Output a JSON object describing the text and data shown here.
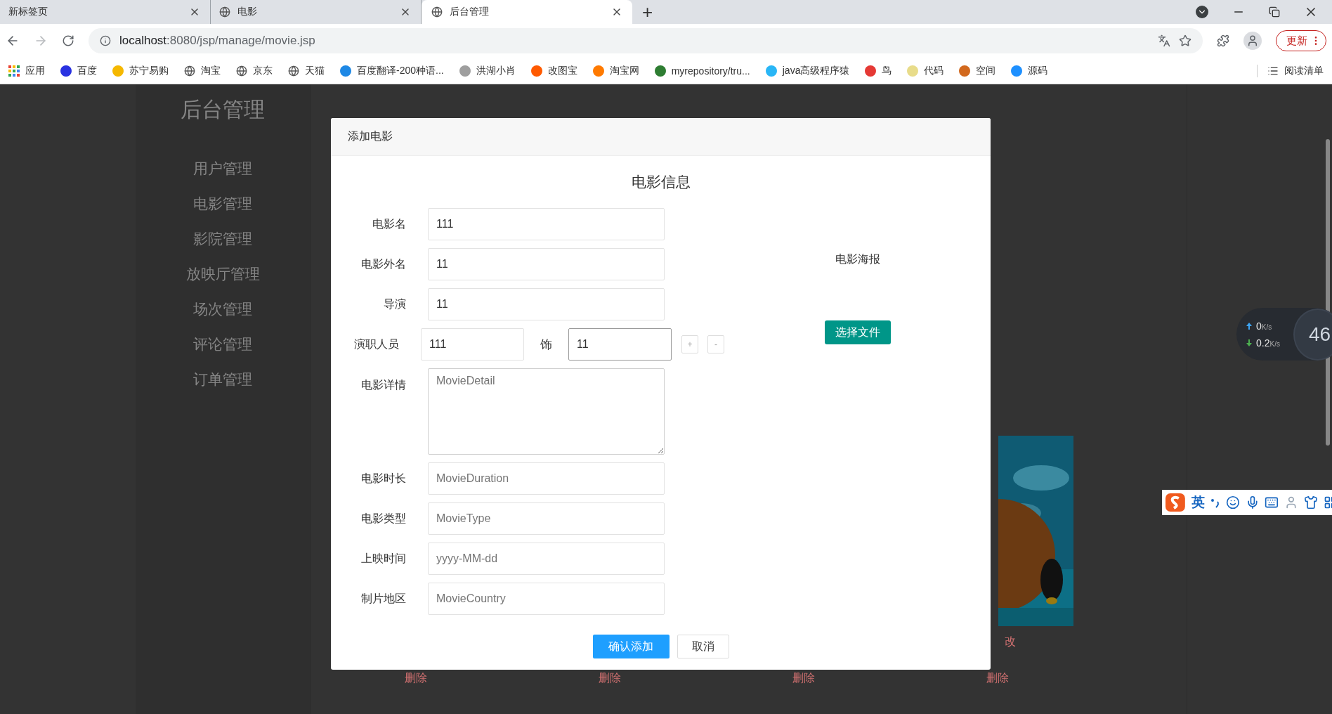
{
  "browser": {
    "tabs": [
      {
        "title": "新标签页",
        "favicon": false,
        "selected": false
      },
      {
        "title": "电影",
        "favicon": true,
        "selected": false
      },
      {
        "title": "后台管理",
        "favicon": true,
        "selected": true
      }
    ],
    "new_tab": "+",
    "address": {
      "host": "localhost",
      "rest": ":8080/jsp/manage/movie.jsp"
    },
    "update_button": "更新",
    "bookmarks": [
      {
        "label": "应用",
        "kind": "apps"
      },
      {
        "label": "百度",
        "kind": "site",
        "color": "#2932e1"
      },
      {
        "label": "苏宁易购",
        "kind": "site",
        "color": "#f5b800"
      },
      {
        "label": "淘宝",
        "kind": "globe"
      },
      {
        "label": "京东",
        "kind": "globe"
      },
      {
        "label": "天猫",
        "kind": "globe"
      },
      {
        "label": "百度翻译-200种语...",
        "kind": "site",
        "color": "#1e88e5"
      },
      {
        "label": "洪湖小肖",
        "kind": "site",
        "color": "#9e9e9e"
      },
      {
        "label": "改图宝",
        "kind": "site",
        "color": "#ff5a00"
      },
      {
        "label": "淘宝网",
        "kind": "site",
        "color": "#ff7a00"
      },
      {
        "label": "myrepository/tru...",
        "kind": "site",
        "color": "#2e7d32"
      },
      {
        "label": "java高级程序猿",
        "kind": "site",
        "color": "#29b6f6"
      },
      {
        "label": "鸟",
        "kind": "site",
        "color": "#e53935"
      },
      {
        "label": "代码",
        "kind": "site",
        "color": "#e8dc8a"
      },
      {
        "label": "空间",
        "kind": "site",
        "color": "#d2691e"
      },
      {
        "label": "源码",
        "kind": "site",
        "color": "#1e90ff"
      }
    ],
    "reading_list": "阅读清单"
  },
  "sidebar": {
    "title": "后台管理",
    "items": [
      {
        "label": "用户管理"
      },
      {
        "label": "电影管理"
      },
      {
        "label": "影院管理"
      },
      {
        "label": "放映厅管理"
      },
      {
        "label": "场次管理"
      },
      {
        "label": "评论管理"
      },
      {
        "label": "订单管理"
      }
    ]
  },
  "movie_cards": [
    {
      "delete": "删除"
    },
    {
      "delete": "删除"
    },
    {
      "delete": "删除"
    },
    {
      "edit": "改",
      "delete": "删除"
    }
  ],
  "modal": {
    "title": "添加电影",
    "section_title": "电影信息",
    "fields": [
      {
        "kind": "text",
        "label": "电影名",
        "value": "111"
      },
      {
        "kind": "text",
        "label": "电影外名",
        "value": "11"
      },
      {
        "kind": "text",
        "label": "导演",
        "value": "11"
      },
      {
        "kind": "actor",
        "label": "演职人员",
        "actor": {
          "value": "111",
          "focused": false
        },
        "role_label": "饰",
        "role": {
          "value": "11",
          "focused": true
        },
        "add": "+",
        "remove": "-"
      },
      {
        "kind": "textarea",
        "label": "电影详情",
        "placeholder": "MovieDetail"
      },
      {
        "kind": "text",
        "label": "电影时长",
        "placeholder": "MovieDuration"
      },
      {
        "kind": "text",
        "label": "电影类型",
        "placeholder": "MovieType"
      },
      {
        "kind": "text",
        "label": "上映时间",
        "placeholder": "yyyy-MM-dd"
      },
      {
        "kind": "text",
        "label": "制片地区",
        "placeholder": "MovieCountry"
      }
    ],
    "poster_label": "电影海报",
    "file_button": "选择文件",
    "confirm_button": "确认添加",
    "cancel_button": "取消"
  },
  "speed_widget": {
    "up": {
      "value": "0",
      "unit": "K/s"
    },
    "down": {
      "value": "0.2",
      "unit": "K/s"
    },
    "load": "46"
  },
  "ime_bar": {
    "mode": "英"
  }
}
